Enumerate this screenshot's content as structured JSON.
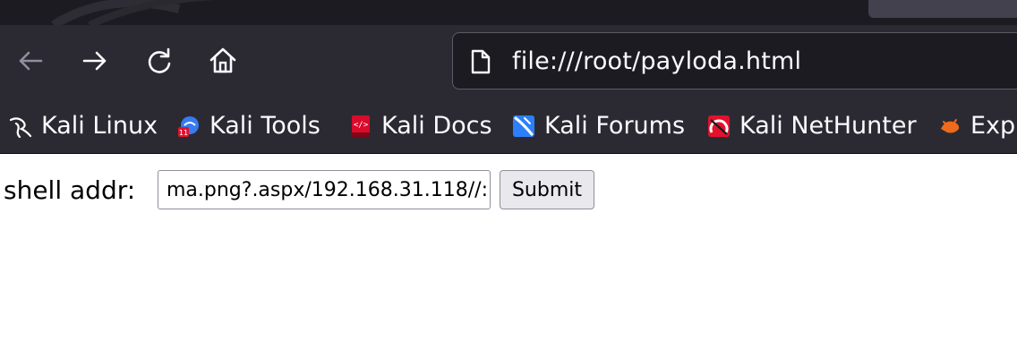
{
  "toolbar": {
    "back_icon": "back-arrow-icon",
    "forward_icon": "forward-arrow-icon",
    "reload_icon": "reload-icon",
    "home_icon": "home-icon"
  },
  "urlbar": {
    "url": "file:///root/payloda.html",
    "page_icon": "page-icon"
  },
  "bookmarks": [
    {
      "label": "Kali Linux",
      "icon": "kali-dragon-icon",
      "color": "#ffffff"
    },
    {
      "label": "Kali Tools",
      "icon": "kali-tools-icon",
      "color": "#367bf0"
    },
    {
      "label": "Kali Docs",
      "icon": "kali-docs-icon",
      "color": "#d90b2b"
    },
    {
      "label": "Kali Forums",
      "icon": "kali-forums-icon",
      "color": "#2d7ff9"
    },
    {
      "label": "Kali NetHunter",
      "icon": "kali-nethunter-icon",
      "color": "#e3112c"
    },
    {
      "label": "Exp",
      "icon": "exploit-db-icon",
      "color": "#ee6a1c"
    }
  ],
  "form": {
    "label": "shell addr:",
    "input_value": "://192.168.31.118/ma.png?.aspx",
    "submit_label": "Submit"
  },
  "colors": {
    "toolbar_bg": "#2b2a33",
    "tabstrip_bg": "#1c1b22",
    "urlbar_bg": "#1c1b22",
    "text_light": "#fbfbfe"
  }
}
